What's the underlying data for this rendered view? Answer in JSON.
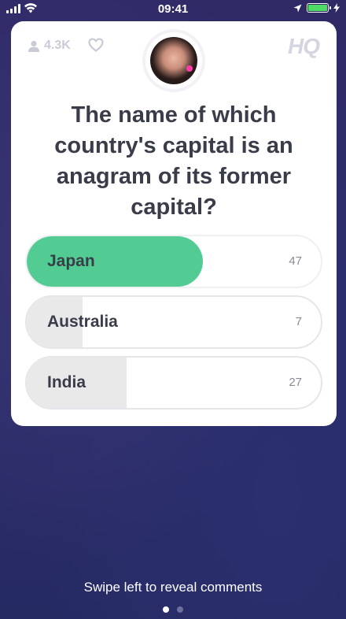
{
  "status_bar": {
    "time": "09:41",
    "signal_icon": "signal-bars-icon",
    "wifi_icon": "wifi-icon",
    "location_icon": "location-arrow-icon",
    "battery_icon": "battery-icon",
    "charging_icon": "charging-bolt-icon",
    "battery_color": "#4cd964"
  },
  "card": {
    "viewers_count": "4.3K",
    "viewers_icon": "person-icon",
    "heart_icon": "heart-icon",
    "brand_logo": "HQ",
    "host_avatar": "host-avatar",
    "question": "The name of which country's capital is an anagram of its former capital?",
    "answers": [
      {
        "label": "Japan",
        "count": "47",
        "correct": true,
        "fill_fraction": 0.6
      },
      {
        "label": "Australia",
        "count": "7",
        "correct": false,
        "fill_fraction": 0.19
      },
      {
        "label": "India",
        "count": "27",
        "correct": false,
        "fill_fraction": 0.34
      }
    ],
    "colors": {
      "correct": "#53cc94",
      "bar": "#e9e9ea"
    }
  },
  "footer": {
    "hint": "Swipe left to reveal comments",
    "pages": 2,
    "active_page": 1
  }
}
